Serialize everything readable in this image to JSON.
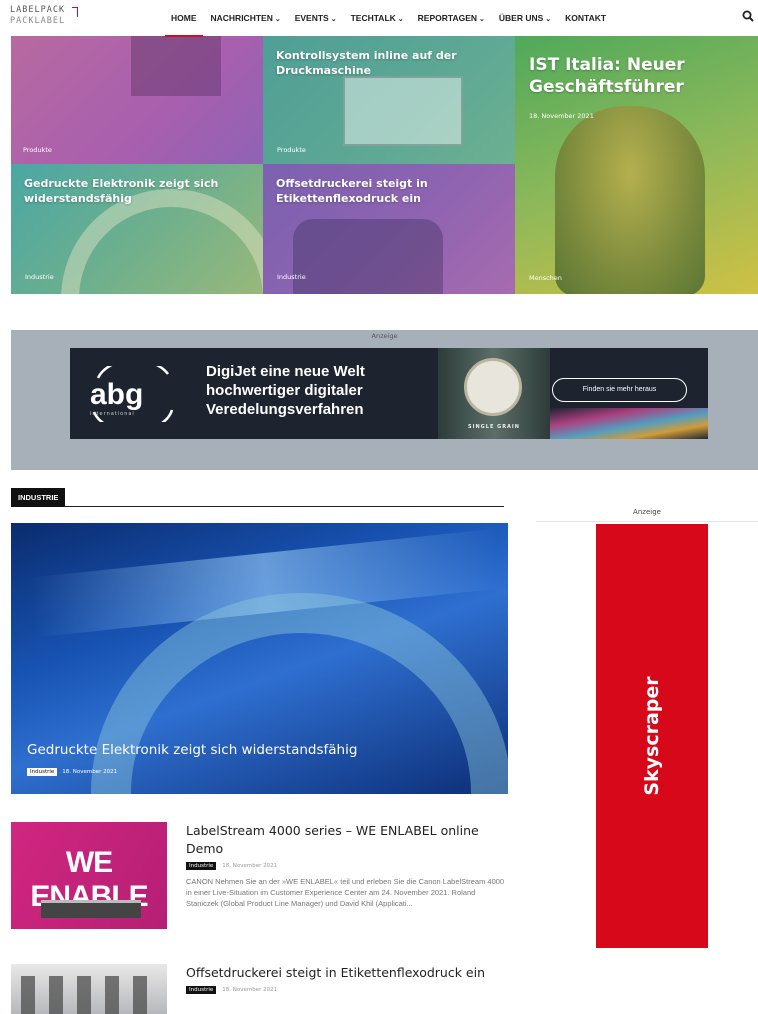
{
  "logo": {
    "line1": "LABELPACK",
    "line2": "PACKLABEL"
  },
  "nav": {
    "items": [
      {
        "label": "HOME",
        "has_dropdown": false,
        "active": true
      },
      {
        "label": "NACHRICHTEN",
        "has_dropdown": true
      },
      {
        "label": "EVENTS",
        "has_dropdown": true
      },
      {
        "label": "TECHTALK",
        "has_dropdown": true
      },
      {
        "label": "REPORTAGEN",
        "has_dropdown": true
      },
      {
        "label": "ÜBER UNS",
        "has_dropdown": true
      },
      {
        "label": "KONTAKT",
        "has_dropdown": false
      }
    ],
    "search_icon": "search-icon"
  },
  "hero": {
    "tile1": {
      "category": "Produkte"
    },
    "tile2": {
      "title": "Kontrollsystem inline auf der Druckmaschine",
      "category": "Produkte"
    },
    "tile3": {
      "title": "IST Italia: Neuer Geschäftsführer",
      "date": "18. November 2021",
      "category": "Menschen"
    },
    "tile4": {
      "title": "Gedruckte Elektronik zeigt sich widerstandsfähig",
      "category": "Industrie"
    },
    "tile5": {
      "title": "Offsetdruckerei steigt in Etikettenflexodruck ein",
      "category": "Industrie"
    }
  },
  "ad": {
    "label": "Anzeige",
    "logo_text": "abg",
    "logo_sub": "international",
    "headline_1": "DigiJet eine neue Welt",
    "headline_2": "hochwertiger digitaler",
    "headline_3": "Veredelungsverfahren",
    "bottle_label": "SINGLE GRAIN",
    "cta": "Finden sie mehr heraus"
  },
  "section": {
    "tag": "INDUSTRIE"
  },
  "sidebar": {
    "ad_label": "Anzeige",
    "skyscraper": "Skyscraper"
  },
  "feature": {
    "title": "Gedruckte Elektronik zeigt sich widerstandsfähig",
    "category": "Industrie",
    "date": "18. November 2021"
  },
  "articles": [
    {
      "title": "LabelStream 4000 series – WE ENLABEL online Demo",
      "category": "Industrie",
      "date": "18. November 2021",
      "excerpt": "CANON    Nehmen Sie an der »WE ENLABEL« teil und erleben Sie die Canon LabelStream 4000 in einer Live-Situation im Customer Experience Center am 24. November 2021. Roland Staniczek (Global Product Line Manager) und David Khil (Applicati...",
      "thumb_text": "WE ENABLE"
    },
    {
      "title": "Offsetdruckerei steigt in Etikettenflexodruck ein",
      "category": "Industrie",
      "date": "18. November 2021"
    }
  ],
  "colors": {
    "accent": "#c8102e",
    "skyscraper": "#d6081a",
    "ad_bg": "#a7b0b8",
    "banner_bg": "#1d2430"
  }
}
